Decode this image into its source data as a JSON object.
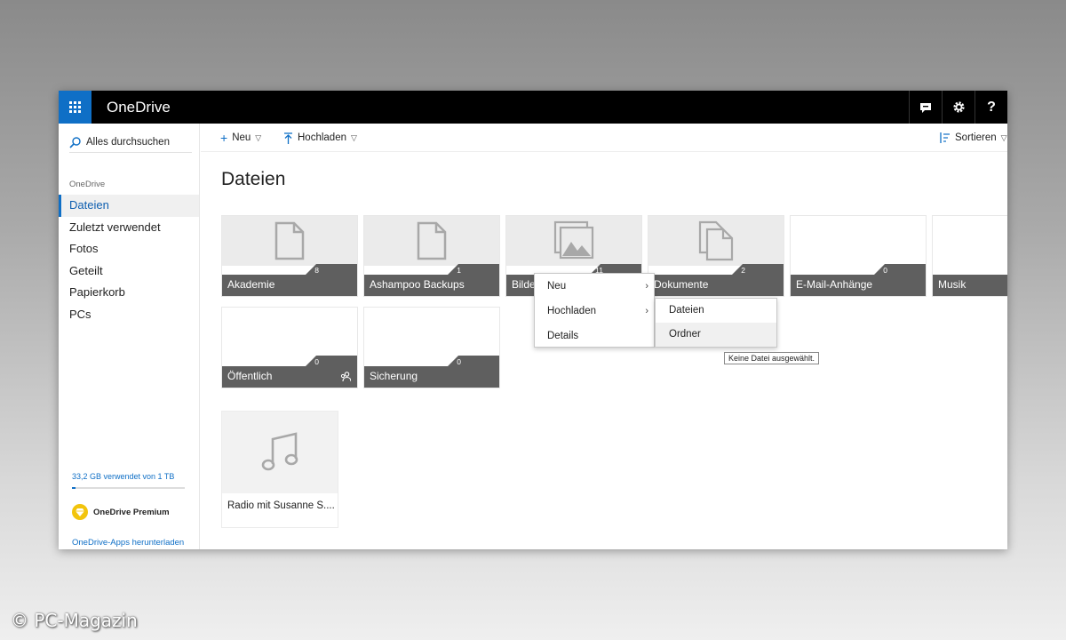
{
  "app": {
    "title": "OneDrive"
  },
  "sidebar": {
    "search_label": "Alles durchsuchen",
    "section_label": "OneDrive",
    "items": [
      {
        "label": "Dateien",
        "active": true
      },
      {
        "label": "Zuletzt verwendet"
      },
      {
        "label": "Fotos"
      },
      {
        "label": "Geteilt"
      },
      {
        "label": "Papierkorb"
      },
      {
        "label": "PCs"
      }
    ],
    "storage_text": "33,2 GB verwendet von 1 TB",
    "storage_fraction": 0.033,
    "premium_label": "OneDrive Premium",
    "apps_link": "OneDrive-Apps herunterladen"
  },
  "commandbar": {
    "new_label": "Neu",
    "upload_label": "Hochladen",
    "sort_label": "Sortieren"
  },
  "main": {
    "title": "Dateien",
    "folders": [
      {
        "name": "Akademie",
        "count": "8",
        "icon": "document-icon"
      },
      {
        "name": "Ashampoo Backups",
        "count": "1",
        "icon": "document-icon"
      },
      {
        "name": "Bilder",
        "count": "11",
        "icon": "photos-icon"
      },
      {
        "name": "Dokumente",
        "count": "2",
        "icon": "documents-icon"
      },
      {
        "name": "E-Mail-Anhänge",
        "count": "0",
        "icon": ""
      },
      {
        "name": "Musik",
        "count": "",
        "icon": ""
      },
      {
        "name": "Öffentlich",
        "count": "0",
        "icon": "",
        "shared": true
      },
      {
        "name": "Sicherung",
        "count": "0",
        "icon": ""
      }
    ],
    "files": [
      {
        "name": "Radio mit Susanne S....",
        "icon": "music-note-icon"
      }
    ]
  },
  "context_menu": {
    "items": [
      "Neu",
      "Hochladen",
      "Details"
    ],
    "submenu": [
      "Dateien",
      "Ordner"
    ],
    "tooltip": "Keine Datei ausgewählt."
  },
  "watermark": "© PC-Magazin",
  "colors": {
    "accent": "#0f6fc6",
    "topbar": "#000000",
    "tile_band": "#5f5f5f"
  }
}
